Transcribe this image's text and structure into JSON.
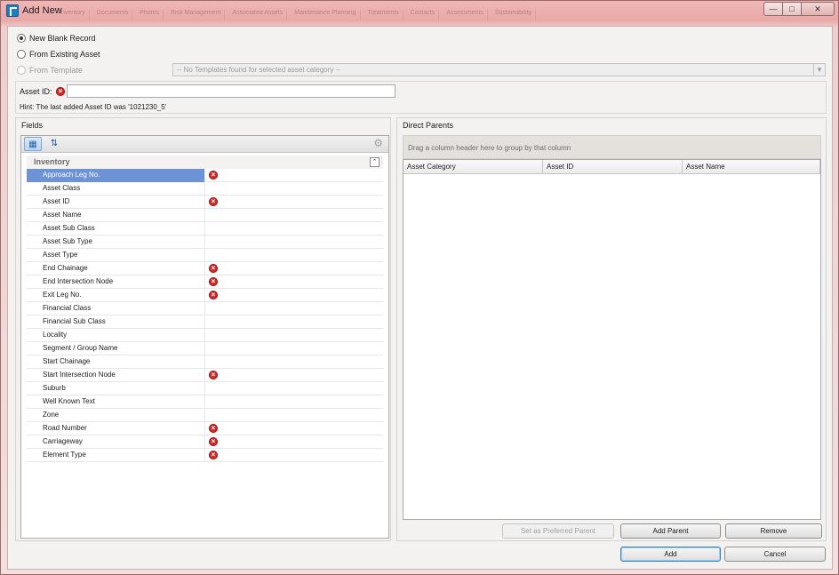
{
  "window": {
    "title": "Add New",
    "background_tabs": [
      "Inventory",
      "Documents",
      "Photos",
      "Risk Management",
      "Associated Assets",
      "Maintenance Planning",
      "Treatments",
      "Contacts",
      "Assessments",
      "Sustainability"
    ],
    "controls": {
      "minimize": "—",
      "maximize": "□",
      "close": "✕"
    }
  },
  "options": {
    "new_blank": "New Blank Record",
    "from_existing": "From Existing Asset",
    "from_template": "From Template",
    "template_placeholder": "-- No Templates found for selected asset category --"
  },
  "asset_id": {
    "label": "Asset ID:",
    "value": "",
    "hint": "Hint: The last added Asset ID was '1021230_5'"
  },
  "fields_panel": {
    "title": "Fields",
    "category": "Inventory",
    "rows": [
      {
        "name": "Approach Leg No.",
        "required": true
      },
      {
        "name": "Asset Class",
        "required": false
      },
      {
        "name": "Asset ID",
        "required": true
      },
      {
        "name": "Asset Name",
        "required": false
      },
      {
        "name": "Asset Sub Class",
        "required": false
      },
      {
        "name": "Asset Sub Type",
        "required": false
      },
      {
        "name": "Asset Type",
        "required": false
      },
      {
        "name": "End Chainage",
        "required": true
      },
      {
        "name": "End Intersection Node",
        "required": true
      },
      {
        "name": "Exit Leg No.",
        "required": true
      },
      {
        "name": "Financial Class",
        "required": false
      },
      {
        "name": "Financial Sub Class",
        "required": false
      },
      {
        "name": "Locality",
        "required": false
      },
      {
        "name": "Segment / Group Name",
        "required": false
      },
      {
        "name": "Start Chainage",
        "required": false
      },
      {
        "name": "Start Intersection Node",
        "required": true
      },
      {
        "name": "Suburb",
        "required": false
      },
      {
        "name": "Well Known Text",
        "required": false
      },
      {
        "name": "Zone",
        "required": false
      },
      {
        "name": "Road Number",
        "required": true
      },
      {
        "name": "Carriageway",
        "required": true
      },
      {
        "name": "Element Type",
        "required": true
      }
    ]
  },
  "parents_panel": {
    "title": "Direct Parents",
    "group_hint": "Drag a column header here to group by that column",
    "columns": [
      "Asset Category",
      "Asset ID",
      "Asset Name"
    ],
    "set_preferred": "Set as Preferred Parent",
    "add_parent": "Add Parent",
    "remove": "Remove"
  },
  "footer": {
    "add": "Add",
    "cancel": "Cancel"
  },
  "colors": {
    "selected_row": "#6d93d6",
    "error_icon": "#d22b2b",
    "title_bar": "#e9a8a8"
  },
  "icons": {
    "required": "error-icon",
    "categorized": "categorized-icon",
    "sort": "sort-alpha-icon",
    "settings": "gear-icon"
  }
}
